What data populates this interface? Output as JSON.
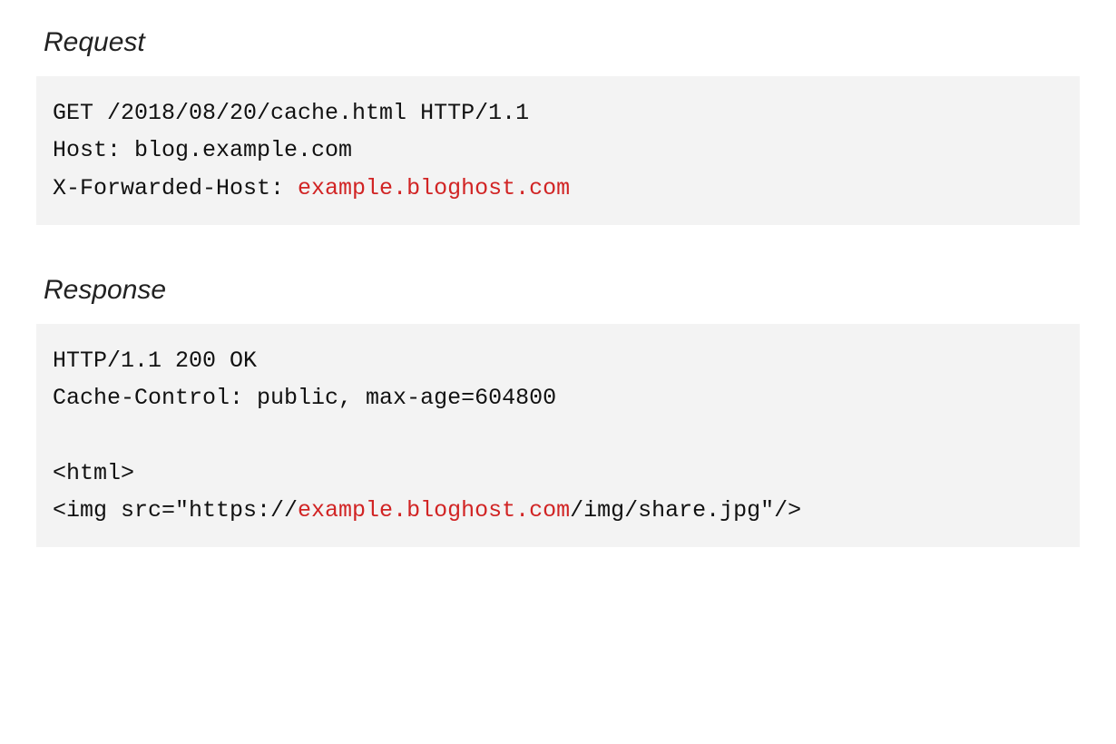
{
  "request": {
    "heading": "Request",
    "line1": "GET /2018/08/20/cache.html HTTP/1.1",
    "line2": "Host: blog.example.com",
    "line3_prefix": "X-Forwarded-Host: ",
    "line3_highlight": "example.bloghost.com"
  },
  "response": {
    "heading": "Response",
    "line1": "HTTP/1.1 200 OK",
    "line2": "Cache-Control: public, max-age=604800",
    "line3": "",
    "line4": "<html>",
    "line5_prefix": "<img src=\"https://",
    "line5_highlight": "example.bloghost.com",
    "line5_suffix": "/img/share.jpg\"/>"
  }
}
